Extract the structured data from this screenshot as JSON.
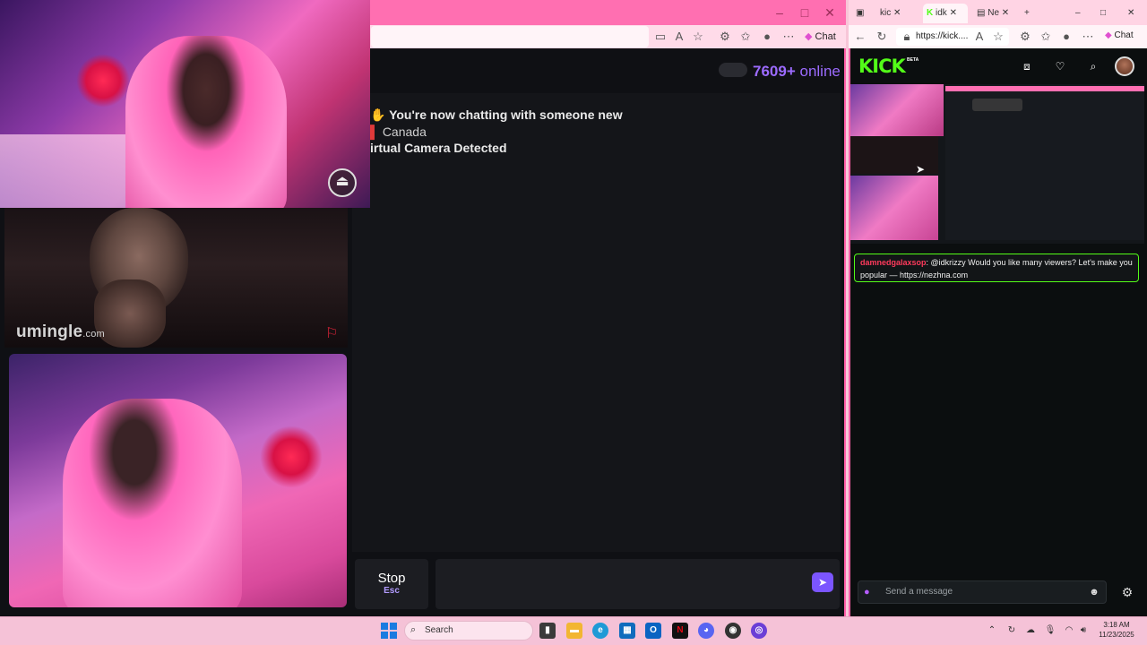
{
  "left_browser": {
    "chat_button_label": "Chat",
    "online_count": "7609+",
    "online_label": "online",
    "chat_lines": [
      "You're now chatting with someone new",
      "Canada",
      "irtual Camera Detected"
    ],
    "stop_label": "Stop",
    "stop_shortcut": "Esc",
    "site_logo": "umingle",
    "site_logo_suffix": ".com"
  },
  "right_browser": {
    "tabs": [
      "kic",
      "idk",
      "Ne"
    ],
    "url": "https://kick....",
    "chat_button_label": "Chat",
    "kick_logo": "KICK",
    "kick_badge": "BETA",
    "pinned_message": {
      "user": "damnedgalaxsop",
      "text": ": @idkrizzy Would you like many viewers? Let's make you popular — https://nezhna.com"
    },
    "send_placeholder": "Send a message"
  },
  "taskbar": {
    "search_label": "Search",
    "time": "3:18 AM",
    "date": "11/23/2025"
  },
  "colors": {
    "accent_purple": "#7b55ff",
    "online_purple": "#9c6bff",
    "kick_green": "#53fc18",
    "window_pink": "#ff6fb1"
  },
  "icons": [
    "back-icon",
    "refresh-icon",
    "lock-icon",
    "star-icon",
    "profile-icon",
    "more-icon",
    "send-icon",
    "flag-icon",
    "mic-icon",
    "emoji-icon",
    "settings-icon",
    "search-icon",
    "wifi-icon",
    "volume-icon",
    "battery-icon"
  ]
}
